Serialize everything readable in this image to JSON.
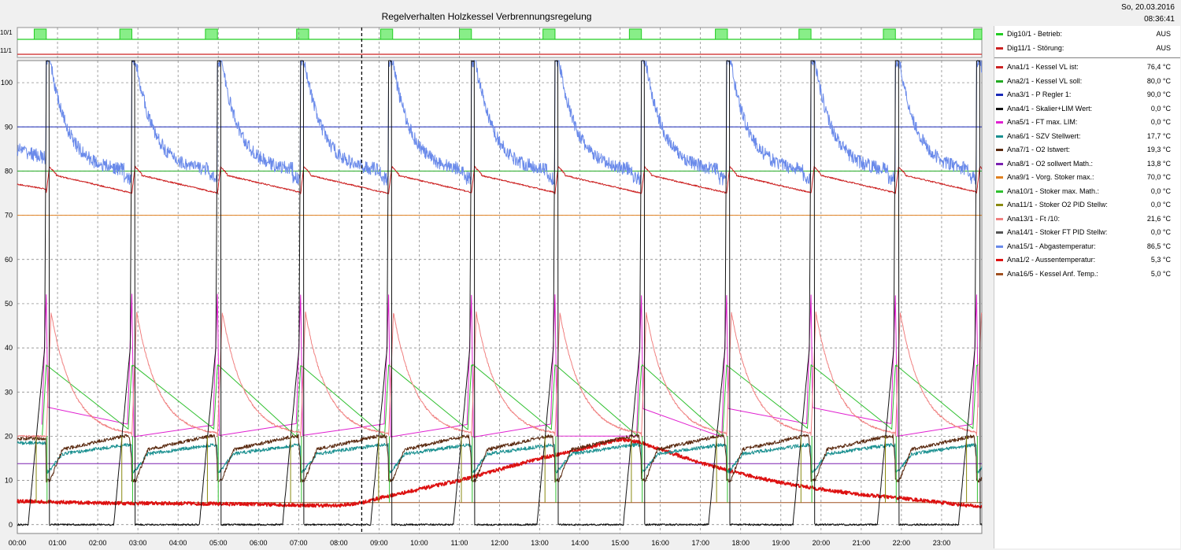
{
  "window": {
    "title": "Regelverhalten Holzkessel Verbrennungsregelung",
    "date": "So, 20.03.2016",
    "time": "08:36:41"
  },
  "legend": {
    "digital": [
      {
        "label": "Dig10/1 - Betrieb:",
        "value": "AUS",
        "color": "#22cc22"
      },
      {
        "label": "Dig11/1 - Störung:",
        "value": "AUS",
        "color": "#cc2222"
      }
    ],
    "analog": [
      {
        "label": "Ana1/1 - Kessel VL ist:",
        "value": "76,4 °C",
        "color": "#cc2222"
      },
      {
        "label": "Ana2/1 - Kessel VL soll:",
        "value": "80,0 °C",
        "color": "#22aa22"
      },
      {
        "label": "Ana3/1 - P Regler 1:",
        "value": "90,0 °C",
        "color": "#1a2ab8"
      },
      {
        "label": "Ana4/1 - Skalier+LIM Wert:",
        "value": "0,0 °C",
        "color": "#111111"
      },
      {
        "label": "Ana5/1 - FT max. LIM:",
        "value": "0,0 °C",
        "color": "#e020d0"
      },
      {
        "label": "Ana6/1 - SZV Stellwert:",
        "value": "17,7 °C",
        "color": "#1a9090"
      },
      {
        "label": "Ana7/1 - O2 Istwert:",
        "value": "19,3 °C",
        "color": "#5a2a10"
      },
      {
        "label": "Ana8/1 - O2 sollwert Math.:",
        "value": "13,8 °C",
        "color": "#7a20b0"
      },
      {
        "label": "Ana9/1 - Vorg. Stoker max.:",
        "value": "70,0 °C",
        "color": "#e08020"
      },
      {
        "label": "Ana10/1 - Stoker max. Math.:",
        "value": "0,0 °C",
        "color": "#30c030"
      },
      {
        "label": "Ana11/1 - Stoker O2 PID Stellw:",
        "value": "0,0 °C",
        "color": "#8a8a10"
      },
      {
        "label": "Ana13/1 - Ft /10:",
        "value": "21,6 °C",
        "color": "#f08080"
      },
      {
        "label": "Ana14/1 - Stoker FT PID Stellw:",
        "value": "0,0 °C",
        "color": "#555555"
      },
      {
        "label": "Ana15/1 - Abgastemperatur:",
        "value": "86,5 °C",
        "color": "#6a8aea"
      },
      {
        "label": "Ana1/2 - Aussentemperatur:",
        "value": "5,3 °C",
        "color": "#dd1111"
      },
      {
        "label": "Ana16/5 - Kessel Anf. Temp.:",
        "value": "5,0 °C",
        "color": "#a05020"
      }
    ]
  },
  "chart_data": {
    "type": "line",
    "title": "Regelverhalten Holzkessel Verbrennungsregelung",
    "xlabel": "",
    "ylabel": "",
    "x_unit": "hours (00:00-24:00)",
    "xlim": [
      0,
      24
    ],
    "ylim": [
      -2,
      105
    ],
    "grid": true,
    "cursor_x": 8.57,
    "y_ticks": [
      "0",
      "10",
      "20",
      "30",
      "40",
      "50",
      "60",
      "70",
      "80",
      "90",
      "100"
    ],
    "x_ticks": [
      "00:00",
      "01:00",
      "02:00",
      "03:00",
      "04:00",
      "05:00",
      "06:00",
      "07:00",
      "08:00",
      "09:00",
      "10:00",
      "11:00",
      "12:00",
      "13:00",
      "14:00",
      "15:00",
      "16:00",
      "17:00",
      "18:00",
      "19:00",
      "20:00",
      "21:00",
      "22:00",
      "23:00"
    ],
    "digital_labels": [
      "10/1",
      "11/1"
    ],
    "firing_cycles": [
      0.72,
      2.85,
      4.98,
      7.05,
      9.24,
      11.3,
      13.38,
      15.53,
      17.65,
      19.75,
      21.85,
      23.87
    ],
    "digital_on": [
      [
        0.42,
        0.72
      ],
      [
        2.55,
        2.85
      ],
      [
        4.68,
        4.98
      ],
      [
        6.95,
        7.25
      ],
      [
        9.04,
        9.34
      ],
      [
        11.0,
        11.3
      ],
      [
        13.08,
        13.38
      ],
      [
        15.23,
        15.53
      ],
      [
        17.37,
        17.67
      ],
      [
        19.45,
        19.75
      ],
      [
        21.55,
        21.85
      ],
      [
        23.8,
        24.0
      ]
    ],
    "series": [
      {
        "name": "Ana2/1 - Kessel VL soll",
        "constant": 80
      },
      {
        "name": "Ana3/1 - P Regler 1",
        "constant": 90
      },
      {
        "name": "Ana9/1 - Vorg. Stoker max.",
        "constant": 70
      },
      {
        "name": "Ana16/5 - Kessel Anf. Temp.",
        "constant": 5
      },
      {
        "name": "Ana8/1 - O2 sollwert Math.",
        "constant": 13.8
      },
      {
        "name": "Ana1/2 - Aussentemperatur",
        "x": [
          0,
          2,
          4,
          6,
          7,
          8,
          8.6,
          9,
          10,
          11,
          12,
          13,
          14,
          14.5,
          15,
          15.5,
          16,
          17,
          18,
          19,
          20,
          21,
          22,
          23,
          24
        ],
        "y": [
          5.3,
          4.9,
          4.8,
          4.6,
          4.4,
          4.3,
          5.0,
          6.0,
          8.0,
          10.0,
          12.5,
          15.0,
          17.0,
          18.2,
          19.3,
          18.6,
          17.0,
          14.0,
          11.5,
          9.5,
          8.0,
          6.8,
          6.0,
          5.0,
          4.0
        ]
      },
      {
        "name": "Ana1/1 - Kessel VL ist",
        "cycle_shape": "peak 81 after firing, declining to 75"
      },
      {
        "name": "Ana15/1 - Abgastemperatur",
        "cycle_shape": "peak 105 after firing, decaying to 80"
      },
      {
        "name": "Ana5/1 - FT max. LIM",
        "cycle_shape": "spike to 52 during firing"
      },
      {
        "name": "Ana10/1 - Stoker max. Math.",
        "cycle_shape": "spike to 36 during firing"
      },
      {
        "name": "Ana13/1 - Ft /10",
        "cycle_shape": "rise to 48, decay to 20"
      },
      {
        "name": "Ana6/1 - SZV Stellwert",
        "cycle_shape": "dip to 11, recover to 18"
      },
      {
        "name": "Ana7/1 - O2 Istwert",
        "cycle_shape": "dip to 10, recover to 20"
      },
      {
        "name": "Ana4/1 - Skalier+LIM Wert",
        "cycle_shape": "ramp to 100 during firing"
      }
    ]
  }
}
